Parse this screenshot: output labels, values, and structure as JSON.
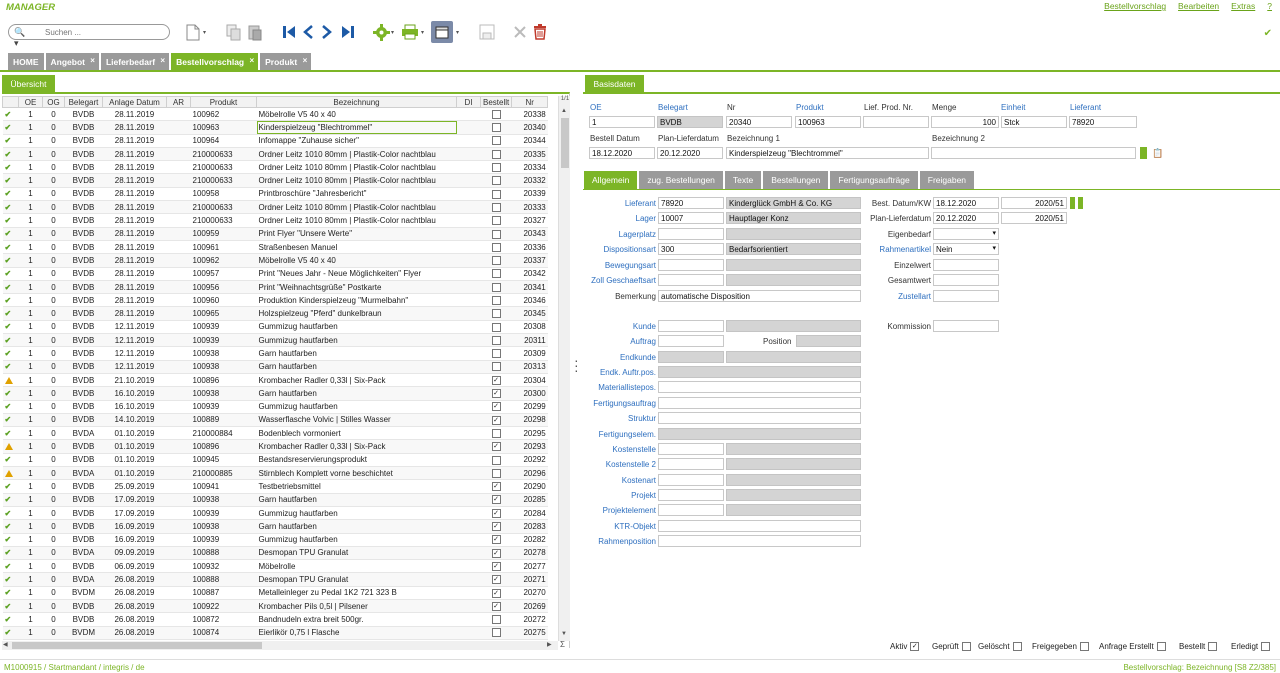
{
  "app": {
    "title": "MANAGER"
  },
  "menu": {
    "items": [
      "Bestellvorschlag",
      "Bearbeiten",
      "Extras",
      "?"
    ]
  },
  "search": {
    "placeholder": "Suchen ..."
  },
  "tabs": [
    {
      "label": "HOME",
      "closable": false,
      "active": false
    },
    {
      "label": "Angebot",
      "closable": true,
      "active": false
    },
    {
      "label": "Lieferbedarf",
      "closable": true,
      "active": false
    },
    {
      "label": "Bestellvorschlag",
      "closable": true,
      "active": true
    },
    {
      "label": "Produkt",
      "closable": true,
      "active": false
    }
  ],
  "overview": {
    "tab_label": "Übersicht"
  },
  "grid": {
    "columns": [
      "",
      "OE",
      "OG",
      "Belegart",
      "Anlage Datum",
      "AR",
      "Produkt",
      "Bezeichnung",
      "DI",
      "Bestellt",
      "Nr"
    ],
    "corner": "1/1",
    "rows": [
      {
        "st": "ok",
        "oe": "1",
        "og": "0",
        "beleg": "BVDB",
        "datum": "28.11.2019",
        "ar": "",
        "prod": "100962",
        "bez": "Möbelrolle V5 40 x 40",
        "di": "",
        "best": false,
        "nr": "20338"
      },
      {
        "st": "ok",
        "oe": "1",
        "og": "0",
        "beleg": "BVDB",
        "datum": "28.11.2019",
        "ar": "",
        "prod": "100963",
        "bez": "Kinderspielzeug \"Blechtrommel\"",
        "di": "",
        "best": false,
        "nr": "20340",
        "sel": true
      },
      {
        "st": "ok",
        "oe": "1",
        "og": "0",
        "beleg": "BVDB",
        "datum": "28.11.2019",
        "ar": "",
        "prod": "100964",
        "bez": " Infomappe \"Zuhause sicher\"",
        "di": "",
        "best": false,
        "nr": "20344"
      },
      {
        "st": "ok",
        "oe": "1",
        "og": "0",
        "beleg": "BVDB",
        "datum": "28.11.2019",
        "ar": "",
        "prod": "210000633",
        "bez": "Ordner Leitz 1010 80mm | Plastik-Color nachtblau",
        "di": "",
        "best": false,
        "nr": "20335"
      },
      {
        "st": "ok",
        "oe": "1",
        "og": "0",
        "beleg": "BVDB",
        "datum": "28.11.2019",
        "ar": "",
        "prod": "210000633",
        "bez": "Ordner Leitz 1010 80mm | Plastik-Color nachtblau",
        "di": "",
        "best": false,
        "nr": "20334"
      },
      {
        "st": "ok",
        "oe": "1",
        "og": "0",
        "beleg": "BVDB",
        "datum": "28.11.2019",
        "ar": "",
        "prod": "210000633",
        "bez": "Ordner Leitz 1010 80mm | Plastik-Color nachtblau",
        "di": "",
        "best": false,
        "nr": "20332"
      },
      {
        "st": "ok",
        "oe": "1",
        "og": "0",
        "beleg": "BVDB",
        "datum": "28.11.2019",
        "ar": "",
        "prod": "100958",
        "bez": "Printbroschüre \"Jahresbericht\"",
        "di": "",
        "best": false,
        "nr": "20339"
      },
      {
        "st": "ok",
        "oe": "1",
        "og": "0",
        "beleg": "BVDB",
        "datum": "28.11.2019",
        "ar": "",
        "prod": "210000633",
        "bez": "Ordner Leitz 1010 80mm | Plastik-Color nachtblau",
        "di": "",
        "best": false,
        "nr": "20333"
      },
      {
        "st": "ok",
        "oe": "1",
        "og": "0",
        "beleg": "BVDB",
        "datum": "28.11.2019",
        "ar": "",
        "prod": "210000633",
        "bez": "Ordner Leitz 1010 80mm | Plastik-Color nachtblau",
        "di": "",
        "best": false,
        "nr": "20327"
      },
      {
        "st": "ok",
        "oe": "1",
        "og": "0",
        "beleg": "BVDB",
        "datum": "28.11.2019",
        "ar": "",
        "prod": "100959",
        "bez": "Print Flyer \"Unsere Werte\"",
        "di": "",
        "best": false,
        "nr": "20343"
      },
      {
        "st": "ok",
        "oe": "1",
        "og": "0",
        "beleg": "BVDB",
        "datum": "28.11.2019",
        "ar": "",
        "prod": "100961",
        "bez": "Straßenbesen Manuel",
        "di": "",
        "best": false,
        "nr": "20336"
      },
      {
        "st": "ok",
        "oe": "1",
        "og": "0",
        "beleg": "BVDB",
        "datum": "28.11.2019",
        "ar": "",
        "prod": "100962",
        "bez": "Möbelrolle V5 40 x 40",
        "di": "",
        "best": false,
        "nr": "20337"
      },
      {
        "st": "ok",
        "oe": "1",
        "og": "0",
        "beleg": "BVDB",
        "datum": "28.11.2019",
        "ar": "",
        "prod": "100957",
        "bez": "Print \"Neues Jahr - Neue Möglichkeiten\" Flyer",
        "di": "",
        "best": false,
        "nr": "20342"
      },
      {
        "st": "ok",
        "oe": "1",
        "og": "0",
        "beleg": "BVDB",
        "datum": "28.11.2019",
        "ar": "",
        "prod": "100956",
        "bez": "Print \"Weihnachtsgrüße\" Postkarte",
        "di": "",
        "best": false,
        "nr": "20341"
      },
      {
        "st": "ok",
        "oe": "1",
        "og": "0",
        "beleg": "BVDB",
        "datum": "28.11.2019",
        "ar": "",
        "prod": "100960",
        "bez": "Produktion Kinderspielzeug \"Murmelbahn\"",
        "di": "",
        "best": false,
        "nr": "20346"
      },
      {
        "st": "ok",
        "oe": "1",
        "og": "0",
        "beleg": "BVDB",
        "datum": "28.11.2019",
        "ar": "",
        "prod": "100965",
        "bez": "Holzspielzeug \"Pferd\" dunkelbraun",
        "di": "",
        "best": false,
        "nr": "20345"
      },
      {
        "st": "ok",
        "oe": "1",
        "og": "0",
        "beleg": "BVDB",
        "datum": "12.11.2019",
        "ar": "",
        "prod": "100939",
        "bez": "Gummizug hautfarben",
        "di": "",
        "best": false,
        "nr": "20308"
      },
      {
        "st": "ok",
        "oe": "1",
        "og": "0",
        "beleg": "BVDB",
        "datum": "12.11.2019",
        "ar": "",
        "prod": "100939",
        "bez": "Gummizug hautfarben",
        "di": "",
        "best": false,
        "nr": "20311"
      },
      {
        "st": "ok",
        "oe": "1",
        "og": "0",
        "beleg": "BVDB",
        "datum": "12.11.2019",
        "ar": "",
        "prod": "100938",
        "bez": "Garn hautfarben",
        "di": "",
        "best": false,
        "nr": "20309"
      },
      {
        "st": "ok",
        "oe": "1",
        "og": "0",
        "beleg": "BVDB",
        "datum": "12.11.2019",
        "ar": "",
        "prod": "100938",
        "bez": "Garn hautfarben",
        "di": "",
        "best": false,
        "nr": "20313"
      },
      {
        "st": "warn",
        "oe": "1",
        "og": "0",
        "beleg": "BVDB",
        "datum": "21.10.2019",
        "ar": "",
        "prod": "100896",
        "bez": "Krombacher Radler 0,33l | Six-Pack",
        "di": "",
        "best": true,
        "nr": "20304"
      },
      {
        "st": "ok",
        "oe": "1",
        "og": "0",
        "beleg": "BVDB",
        "datum": "16.10.2019",
        "ar": "",
        "prod": "100938",
        "bez": "Garn hautfarben",
        "di": "",
        "best": true,
        "nr": "20300"
      },
      {
        "st": "ok",
        "oe": "1",
        "og": "0",
        "beleg": "BVDB",
        "datum": "16.10.2019",
        "ar": "",
        "prod": "100939",
        "bez": "Gummizug hautfarben",
        "di": "",
        "best": true,
        "nr": "20299"
      },
      {
        "st": "ok",
        "oe": "1",
        "og": "0",
        "beleg": "BVDB",
        "datum": "14.10.2019",
        "ar": "",
        "prod": "100889",
        "bez": "Wasserflasche Volvic | Stilles Wasser",
        "di": "",
        "best": true,
        "nr": "20298"
      },
      {
        "st": "ok",
        "oe": "1",
        "og": "0",
        "beleg": "BVDA",
        "datum": "01.10.2019",
        "ar": "",
        "prod": "210000884",
        "bez": "Bodenblech vormoniert",
        "di": "",
        "best": false,
        "nr": "20295"
      },
      {
        "st": "warn",
        "oe": "1",
        "og": "0",
        "beleg": "BVDB",
        "datum": "01.10.2019",
        "ar": "",
        "prod": "100896",
        "bez": "Krombacher Radler 0,33l | Six-Pack",
        "di": "",
        "best": true,
        "nr": "20293"
      },
      {
        "st": "ok",
        "oe": "1",
        "og": "0",
        "beleg": "BVDB",
        "datum": "01.10.2019",
        "ar": "",
        "prod": "100945",
        "bez": "Bestandsreservierungsprodukt",
        "di": "",
        "best": false,
        "nr": "20292"
      },
      {
        "st": "warn",
        "oe": "1",
        "og": "0",
        "beleg": "BVDA",
        "datum": "01.10.2019",
        "ar": "",
        "prod": "210000885",
        "bez": "Stirnblech Komplett vorne beschichtet",
        "di": "",
        "best": false,
        "nr": "20296"
      },
      {
        "st": "ok",
        "oe": "1",
        "og": "0",
        "beleg": "BVDB",
        "datum": "25.09.2019",
        "ar": "",
        "prod": "100941",
        "bez": "Testbetriebsmittel",
        "di": "",
        "best": true,
        "nr": "20290"
      },
      {
        "st": "ok",
        "oe": "1",
        "og": "0",
        "beleg": "BVDB",
        "datum": "17.09.2019",
        "ar": "",
        "prod": "100938",
        "bez": "Garn hautfarben",
        "di": "",
        "best": true,
        "nr": "20285"
      },
      {
        "st": "ok",
        "oe": "1",
        "og": "0",
        "beleg": "BVDB",
        "datum": "17.09.2019",
        "ar": "",
        "prod": "100939",
        "bez": "Gummizug hautfarben",
        "di": "",
        "best": true,
        "nr": "20284"
      },
      {
        "st": "ok",
        "oe": "1",
        "og": "0",
        "beleg": "BVDB",
        "datum": "16.09.2019",
        "ar": "",
        "prod": "100938",
        "bez": "Garn hautfarben",
        "di": "",
        "best": true,
        "nr": "20283"
      },
      {
        "st": "ok",
        "oe": "1",
        "og": "0",
        "beleg": "BVDB",
        "datum": "16.09.2019",
        "ar": "",
        "prod": "100939",
        "bez": "Gummizug hautfarben",
        "di": "",
        "best": true,
        "nr": "20282"
      },
      {
        "st": "ok",
        "oe": "1",
        "og": "0",
        "beleg": "BVDA",
        "datum": "09.09.2019",
        "ar": "",
        "prod": "100888",
        "bez": "Desmopan TPU Granulat",
        "di": "",
        "best": true,
        "nr": "20278"
      },
      {
        "st": "ok",
        "oe": "1",
        "og": "0",
        "beleg": "BVDB",
        "datum": "06.09.2019",
        "ar": "",
        "prod": "100932",
        "bez": "Möbelrolle",
        "di": "",
        "best": true,
        "nr": "20277"
      },
      {
        "st": "ok",
        "oe": "1",
        "og": "0",
        "beleg": "BVDA",
        "datum": "26.08.2019",
        "ar": "",
        "prod": "100888",
        "bez": "Desmopan TPU Granulat",
        "di": "",
        "best": true,
        "nr": "20271"
      },
      {
        "st": "ok",
        "oe": "1",
        "og": "0",
        "beleg": "BVDM",
        "datum": "26.08.2019",
        "ar": "",
        "prod": "100887",
        "bez": "Metalleinleger zu Pedal 1K2 721 323 B",
        "di": "",
        "best": true,
        "nr": "20270"
      },
      {
        "st": "ok",
        "oe": "1",
        "og": "0",
        "beleg": "BVDB",
        "datum": "26.08.2019",
        "ar": "",
        "prod": "100922",
        "bez": "Krombacher Pils 0,5l | Pilsener",
        "di": "",
        "best": true,
        "nr": "20269"
      },
      {
        "st": "ok",
        "oe": "1",
        "og": "0",
        "beleg": "BVDB",
        "datum": "26.08.2019",
        "ar": "",
        "prod": "100872",
        "bez": "Bandnudeln extra breit 500gr.",
        "di": "",
        "best": false,
        "nr": "20272"
      },
      {
        "st": "ok",
        "oe": "1",
        "og": "0",
        "beleg": "BVDM",
        "datum": "26.08.2019",
        "ar": "",
        "prod": "100874",
        "bez": "Eierlikör 0,75 l Flasche",
        "di": "",
        "best": false,
        "nr": "20275"
      }
    ]
  },
  "basisdaten": {
    "tab_label": "Basisdaten",
    "labels": {
      "oe": "OE",
      "belegart": "Belegart",
      "nr": "Nr",
      "produkt": "Produkt",
      "lief_prod_nr": "Lief. Prod. Nr.",
      "menge": "Menge",
      "einheit": "Einheit",
      "lieferant": "Lieferant",
      "bestell_datum": "Bestell Datum",
      "plan_lieferdatum": "Plan-Lieferdatum",
      "bezeichnung1": "Bezeichnung 1",
      "bezeichnung2": "Bezeichnung 2"
    },
    "values": {
      "oe": "1",
      "belegart": "BVDB",
      "nr": "20340",
      "produkt": "100963",
      "lief_prod_nr": "",
      "menge": "100",
      "einheit": "Stck",
      "lieferant": "78920",
      "bestell_datum": "18.12.2020",
      "plan_lieferdatum": "20.12.2020",
      "bezeichnung1": "Kinderspielzeug \"Blechtrommel\"",
      "bezeichnung2": ""
    }
  },
  "subtabs": [
    "Allgemein",
    "zug. Bestellungen",
    "Texte",
    "Bestellungen",
    "Fertigungsaufträge",
    "Freigaben"
  ],
  "allgemein": {
    "lieferant_label": "Lieferant",
    "lieferant": "78920",
    "lieferant_name": "Kinderglück GmbH & Co. KG",
    "lager_label": "Lager",
    "lager": "10007",
    "lager_name": "Hauptlager Konz",
    "lagerplatz_label": "Lagerplatz",
    "disposition_label": "Dispositionsart",
    "disposition": "300",
    "disposition_name": "Bedarfsorientiert",
    "bewegung_label": "Bewegungsart",
    "zoll_label": "Zoll Geschaeftsart",
    "bemerkung_label": "Bemerkung",
    "bemerkung": "automatische Disposition",
    "kunde_label": "Kunde",
    "auftrag_label": "Auftrag",
    "position_label": "Position",
    "endkunde_label": "Endkunde",
    "endk_auftr_label": "Endk. Auftr.pos.",
    "materialliste_label": "Materiallistepos.",
    "fertigungsauftrag_label": "Fertigungsauftrag",
    "struktur_label": "Struktur",
    "fertigungselem_label": "Fertigungselem.",
    "kostenstelle_label": "Kostenstelle",
    "kostenstelle2_label": "Kostenstelle 2",
    "kostenart_label": "Kostenart",
    "projekt_label": "Projekt",
    "projektelement_label": "Projektelement",
    "ktr_label": "KTR-Objekt",
    "rahmenposition_label": "Rahmenposition",
    "best_datum_label": "Best. Datum/KW",
    "best_datum": "18.12.2020",
    "best_kw": "2020/51",
    "plan_label": "Plan-Lieferdatum",
    "plan_datum": "20.12.2020",
    "plan_kw": "2020/51",
    "eigenbedarf_label": "Eigenbedarf",
    "eigenbedarf": "",
    "rahmenartikel_label": "Rahmenartikel",
    "rahmenartikel": "Nein",
    "einzelwert_label": "Einzelwert",
    "gesamtwert_label": "Gesamtwert",
    "zustellart_label": "Zustellart",
    "kommission_label": "Kommission"
  },
  "flags": [
    {
      "label": "Aktiv",
      "checked": true
    },
    {
      "label": "Geprüft",
      "checked": false
    },
    {
      "label": "Gelöscht",
      "checked": false
    },
    {
      "label": "Freigegeben",
      "checked": false
    },
    {
      "label": "Anfrage Erstellt",
      "checked": false
    },
    {
      "label": "Bestellt",
      "checked": false
    },
    {
      "label": "Erledigt",
      "checked": false
    }
  ],
  "status": {
    "left": "M1000915 / Startmandant / integris / de",
    "right": "Bestellvorschlag: Bezeichnung [S8 Z2/385]"
  },
  "colors": {
    "accent": "#7cb526",
    "link": "#2e6fbf",
    "tab_inactive": "#9a9a9a"
  }
}
